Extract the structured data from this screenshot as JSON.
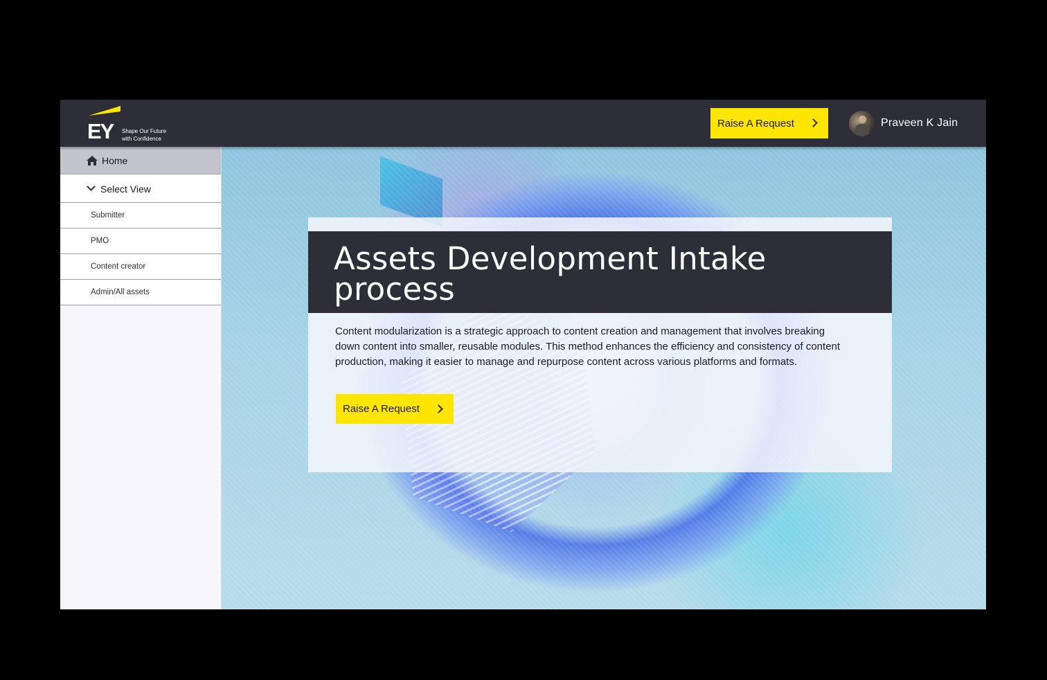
{
  "header": {
    "logo_text": "EY",
    "logo_tagline_1": "Shape Our Future",
    "logo_tagline_2": "with Confidence",
    "raise_request_label": "Raise A Request",
    "user_name": "Praveen K Jain"
  },
  "sidebar": {
    "home_label": "Home",
    "select_view_label": "Select View",
    "items": [
      {
        "label": "Submitter"
      },
      {
        "label": "PMO"
      },
      {
        "label": "Content creator"
      },
      {
        "label": "Admin/All assets"
      }
    ]
  },
  "hero": {
    "title": "Assets Development Intake process",
    "description": "Content modularization is a strategic approach to content creation and management that involves breaking down content into smaller, reusable modules. This method enhances the efficiency and consistency of content production, making it easier to manage and repurpose content across various platforms and formats.",
    "cta_label": "Raise A Request"
  },
  "colors": {
    "brand_yellow": "#ffe600",
    "header_dark": "#2e2e38",
    "sidebar_bg": "#f6f6fa",
    "home_active_bg": "#c4c4cd"
  },
  "icons": [
    "ey-logo",
    "chevron-right-icon",
    "home-icon",
    "chevron-down-icon",
    "avatar"
  ]
}
